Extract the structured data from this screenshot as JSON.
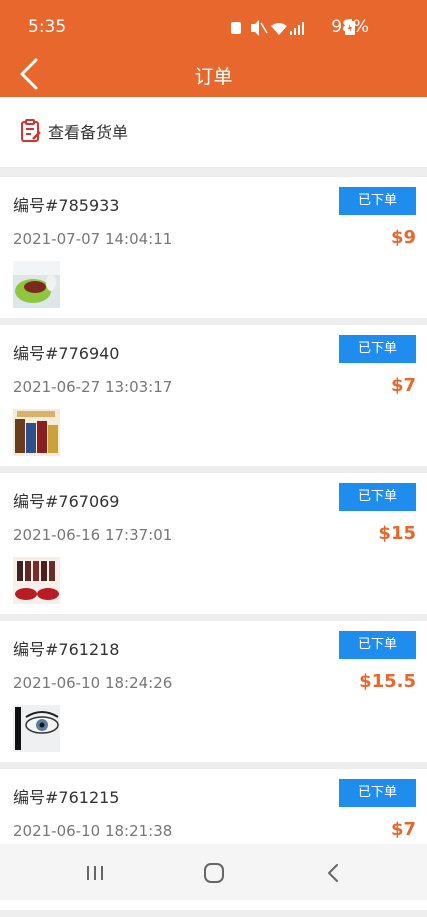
{
  "status": {
    "time": "5:35",
    "battery": "98%"
  },
  "header": {
    "title": "订单"
  },
  "toolbar": {
    "stock_label": "查看备货单"
  },
  "orders": [
    {
      "number": "编号#785933",
      "status": "已下单",
      "date": "2021-07-07 14:04:11",
      "price": "$9"
    },
    {
      "number": "编号#776940",
      "status": "已下单",
      "date": "2021-06-27 13:03:17",
      "price": "$7"
    },
    {
      "number": "编号#767069",
      "status": "已下单",
      "date": "2021-06-16 17:37:01",
      "price": "$15"
    },
    {
      "number": "编号#761218",
      "status": "已下单",
      "date": "2021-06-10 18:24:26",
      "price": "$15.5"
    },
    {
      "number": "编号#761215",
      "status": "已下单",
      "date": "2021-06-10 18:21:38",
      "price": "$7"
    }
  ],
  "colors": {
    "brand": "#e8672c",
    "badge": "#1f8ded",
    "price": "#e8672c"
  },
  "icons": [
    "back-icon",
    "clipboard-icon",
    "recents-icon",
    "home-icon",
    "nav-back-icon"
  ]
}
